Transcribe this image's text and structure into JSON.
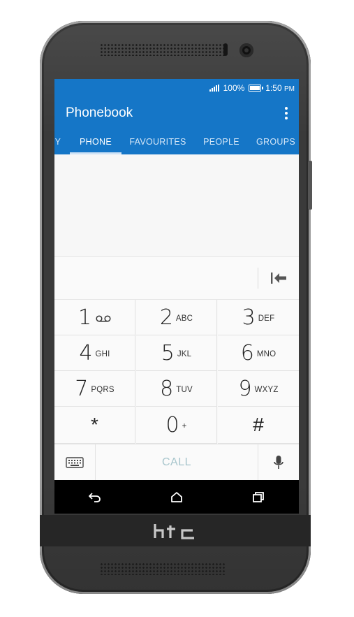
{
  "device": {
    "brand": "HTC"
  },
  "status_bar": {
    "battery": "100%",
    "time": "1:50",
    "time_suffix": "PM"
  },
  "app_bar": {
    "title": "Phonebook"
  },
  "tabs": [
    {
      "label": "Y"
    },
    {
      "label": "PHONE"
    },
    {
      "label": "FAVOURITES"
    },
    {
      "label": "PEOPLE"
    },
    {
      "label": "GROUPS"
    }
  ],
  "active_tab": "PHONE",
  "dial_input": {
    "value": ""
  },
  "keypad": [
    {
      "digit": "1",
      "letters": ""
    },
    {
      "digit": "2",
      "letters": "ABC"
    },
    {
      "digit": "3",
      "letters": "DEF"
    },
    {
      "digit": "4",
      "letters": "GHI"
    },
    {
      "digit": "5",
      "letters": "JKL"
    },
    {
      "digit": "6",
      "letters": "MNO"
    },
    {
      "digit": "7",
      "letters": "PQRS"
    },
    {
      "digit": "8",
      "letters": "TUV"
    },
    {
      "digit": "9",
      "letters": "WXYZ"
    },
    {
      "digit": "*",
      "letters": ""
    },
    {
      "digit": "0",
      "letters": "+"
    },
    {
      "digit": "#",
      "letters": ""
    }
  ],
  "actions": {
    "call_label": "CALL"
  },
  "icons": {
    "voicemail": "voicemail-icon",
    "backspace": "backspace-icon",
    "keyboard": "keyboard-icon",
    "microphone": "microphone-icon",
    "back": "back-icon",
    "home": "home-icon",
    "recents": "recents-icon",
    "overflow": "more-vert-icon"
  },
  "colors": {
    "accent": "#1576c7",
    "call_text": "#a7c5cc",
    "keypad_bg": "#fafafa"
  }
}
